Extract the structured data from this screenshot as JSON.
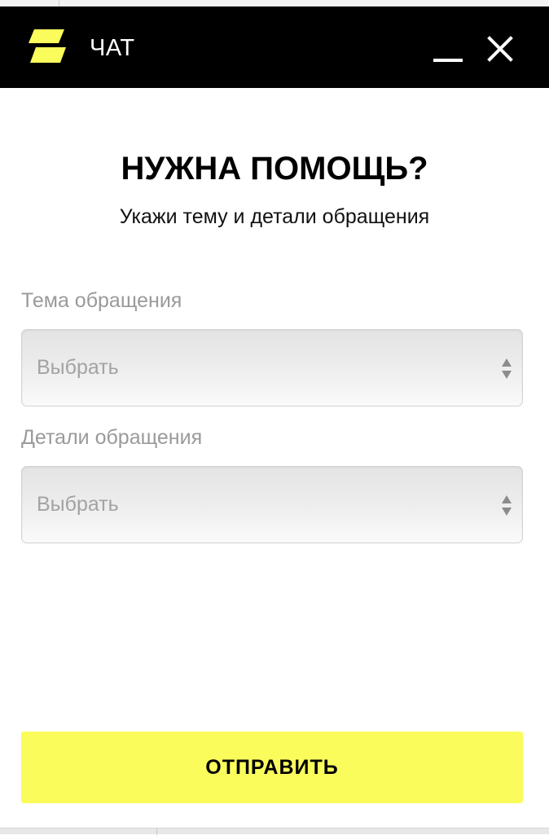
{
  "header": {
    "title": "ЧАТ",
    "logo_icon": "brand-logo-icon",
    "minimize_icon": "minimize-icon",
    "close_icon": "close-icon",
    "background_color": "#000000",
    "brand_color": "#FAFC5C"
  },
  "main": {
    "heading": "НУЖНА ПОМОЩЬ?",
    "subheading": "Укажи тему и детали обращения"
  },
  "form": {
    "topic": {
      "label": "Тема обращения",
      "selected": "Выбрать",
      "arrow_icon": "select-arrows-icon"
    },
    "details": {
      "label": "Детали обращения",
      "selected": "Выбрать",
      "arrow_icon": "select-arrows-icon"
    },
    "submit_label": "ОТПРАВИТЬ",
    "submit_color": "#FAFC5C"
  }
}
